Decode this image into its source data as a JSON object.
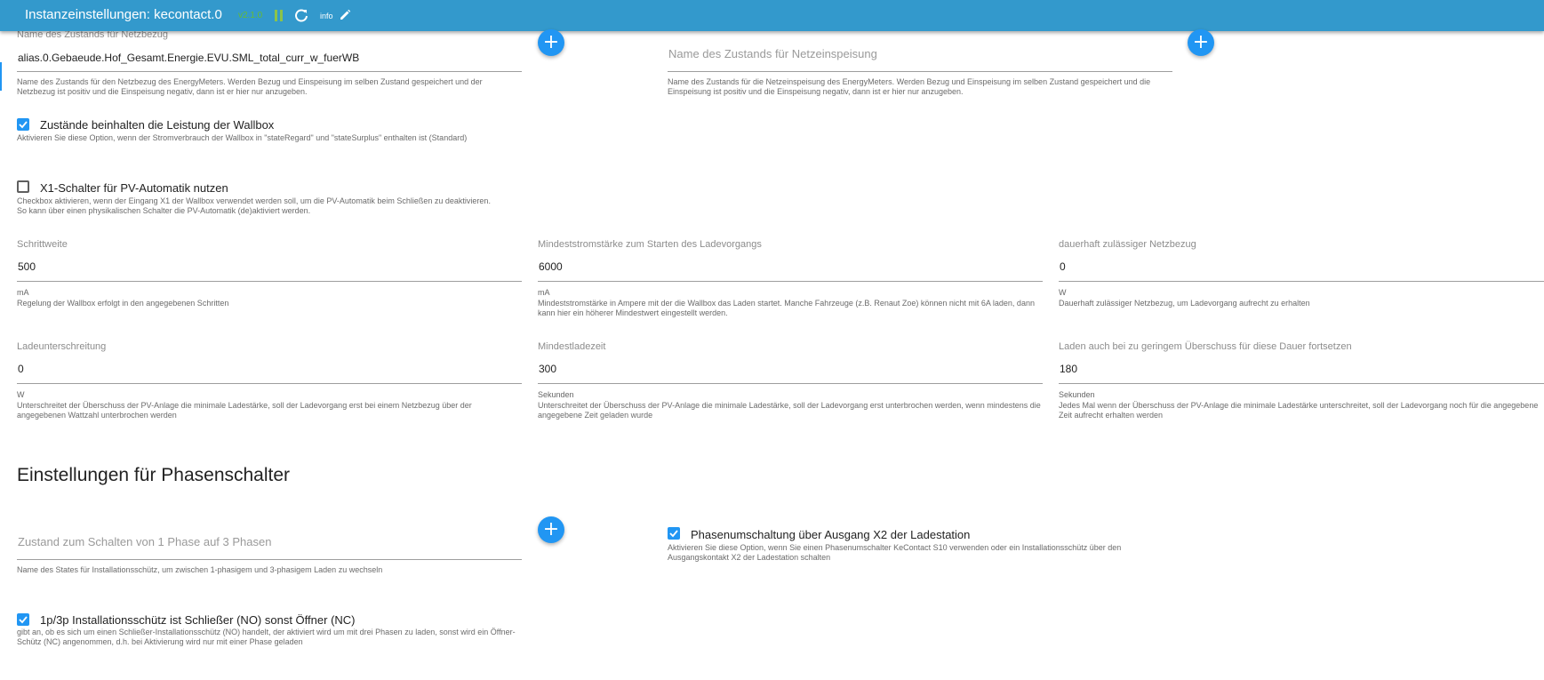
{
  "header": {
    "title": "Instanzeinstellungen: kecontact.0",
    "version": "v2.1.0",
    "info_label": "info",
    "icons": [
      "pause-icon",
      "reload-icon",
      "pencil-icon"
    ]
  },
  "grid_consumption": {
    "label": "Name des Zustands für Netzbezug",
    "value": "alias.0.Gebaeude.Hof_Gesamt.Energie.EVU.SML_total_curr_w_fuerWB",
    "help": "Name des Zustands für den Netzbezug des EnergyMeters. Werden Bezug und Einspeisung im selben Zustand gespeichert und der Netzbezug ist positiv und die Einspeisung negativ, dann ist er hier nur anzugeben.",
    "add_label": "+"
  },
  "grid_feed": {
    "placeholder": "Name des Zustands für Netzeinspeisung",
    "help": "Name des Zustands für die Netzeinspeisung des EnergyMeters. Werden Bezug und Einspeisung im selben Zustand gespeichert und die Einspeisung ist positiv und die Einspeisung negativ, dann ist er hier nur anzugeben.",
    "add_label": "+"
  },
  "states_include_wallbox": {
    "checked": true,
    "label": "Zustände beinhalten die Leistung der Wallbox",
    "help": "Aktivieren Sie diese Option, wenn der Stromverbrauch der Wallbox in \"stateRegard\" und \"stateSurplus\" enthalten ist (Standard)"
  },
  "x1_switch": {
    "checked": false,
    "label": "X1-Schalter für PV-Automatik nutzen",
    "help": "Checkbox aktivieren, wenn der Eingang X1 der Wallbox verwendet werden soll, um die PV-Automatik beim Schließen zu deaktivieren. So kann über einen physikalischen Schalter die PV-Automatik (de)aktiviert werden."
  },
  "step": {
    "label": "Schrittweite",
    "value": "500",
    "unit": "mA",
    "help": "Regelung der Wallbox erfolgt in den angegebenen Schritten"
  },
  "min_current": {
    "label": "Mindeststromstärke zum Starten des Ladevorgangs",
    "value": "6000",
    "unit": "mA",
    "help": "Mindeststromstärke in Ampere mit der die Wallbox das Laden startet. Manche Fahrzeuge (z.B. Renaut Zoe) können nicht mit 6A laden, dann kann hier ein höherer Mindestwert eingestellt werden."
  },
  "permanent_grid": {
    "label": "dauerhaft zulässiger Netzbezug",
    "value": "0",
    "unit": "W",
    "help": "Dauerhaft zulässiger Netzbezug, um Ladevorgang aufrecht zu erhalten"
  },
  "underrun": {
    "label": "Ladeunterschreitung",
    "value": "0",
    "unit": "W",
    "help": "Unterschreitet der Überschuss der PV-Anlage die minimale Ladestärke, soll der Ladevorgang erst bei einem Netzbezug über der angegebenen Wattzahl unterbrochen werden"
  },
  "min_charge_time": {
    "label": "Mindestladezeit",
    "value": "300",
    "unit": "Sekunden",
    "help": "Unterschreitet der Überschuss der PV-Anlage die minimale Ladestärke, soll der Ladevorgang erst unterbrochen werden, wenn mindestens die angegebene Zeit geladen wurde"
  },
  "continue_low": {
    "label": "Laden auch bei zu geringem Überschuss für diese Dauer fortsetzen",
    "value": "180",
    "unit": "Sekunden",
    "help": "Jedes Mal wenn der Überschuss der PV-Anlage die minimale Ladestärke unterschreitet, soll der Ladevorgang noch für die angegebene Zeit aufrecht erhalten werden"
  },
  "phase_section": {
    "title": "Einstellungen für Phasenschalter"
  },
  "phase_state": {
    "placeholder": "Zustand zum Schalten von 1 Phase auf 3 Phasen",
    "help": "Name des States für Installationsschütz, um zwischen 1-phasigem und 3-phasigem Laden zu wechseln",
    "add_label": "+"
  },
  "phase_x2": {
    "checked": true,
    "label": "Phasenumschaltung über Ausgang X2 der Ladestation",
    "help": "Aktivieren Sie diese Option, wenn Sie einen Phasenumschalter KeContact S10 verwenden oder ein Installationsschütz über den Ausgangskontakt X2 der Ladestation schalten"
  },
  "contactor_no": {
    "checked": true,
    "label": "1p/3p Installationsschütz ist Schließer (NO) sonst Öffner (NC)",
    "help": "gibt an, ob es sich um einen Schließer-Installationsschütz (NO) handelt, der aktiviert wird um mit drei Phasen zu laden, sonst wird ein Öffner-Schütz (NC) angenommen, d.h. bei Aktivierung wird nur mit einer Phase geladen"
  },
  "colors": {
    "header": "#3399cc",
    "accent": "#2196f3",
    "version": "#66bb33"
  }
}
